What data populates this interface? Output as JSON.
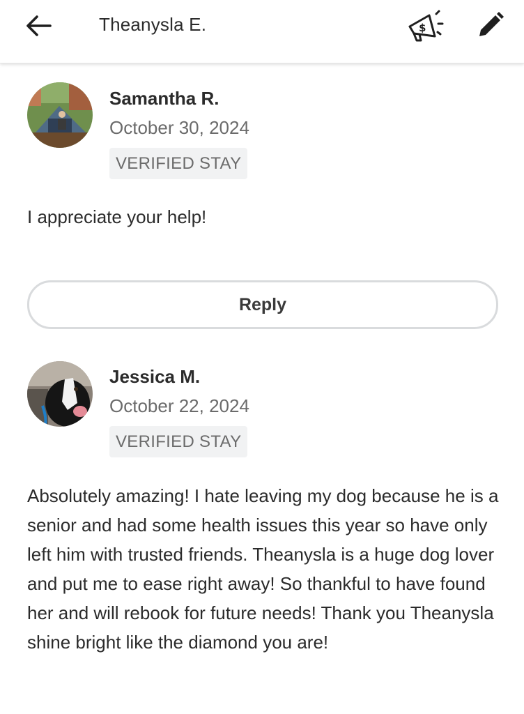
{
  "header": {
    "title": "Theanysla E.",
    "back_icon": "arrow-left-icon",
    "promo_icon": "megaphone-dollar-icon",
    "edit_icon": "pencil-icon"
  },
  "reviews": [
    {
      "name": "Samantha R.",
      "date": "October 30, 2024",
      "badge": "VERIFIED STAY",
      "text": "I appreciate your help!",
      "reply_label": "Reply"
    },
    {
      "name": "Jessica M.",
      "date": "October 22, 2024",
      "badge": "VERIFIED STAY",
      "text": "Absolutely amazing! I hate leaving my dog because he is a senior and had some health issues this year so have only left him with trusted friends. Theanysla is a huge dog lover and put me to ease right away! So thankful to have found her and will rebook for future needs! Thank you Theanysla shine bright like the diamond you are!"
    }
  ],
  "colors": {
    "text_primary": "#2b2b2b",
    "text_secondary": "#6b6b6b",
    "badge_bg": "#f1f2f3",
    "button_border": "#d9dbdd"
  }
}
